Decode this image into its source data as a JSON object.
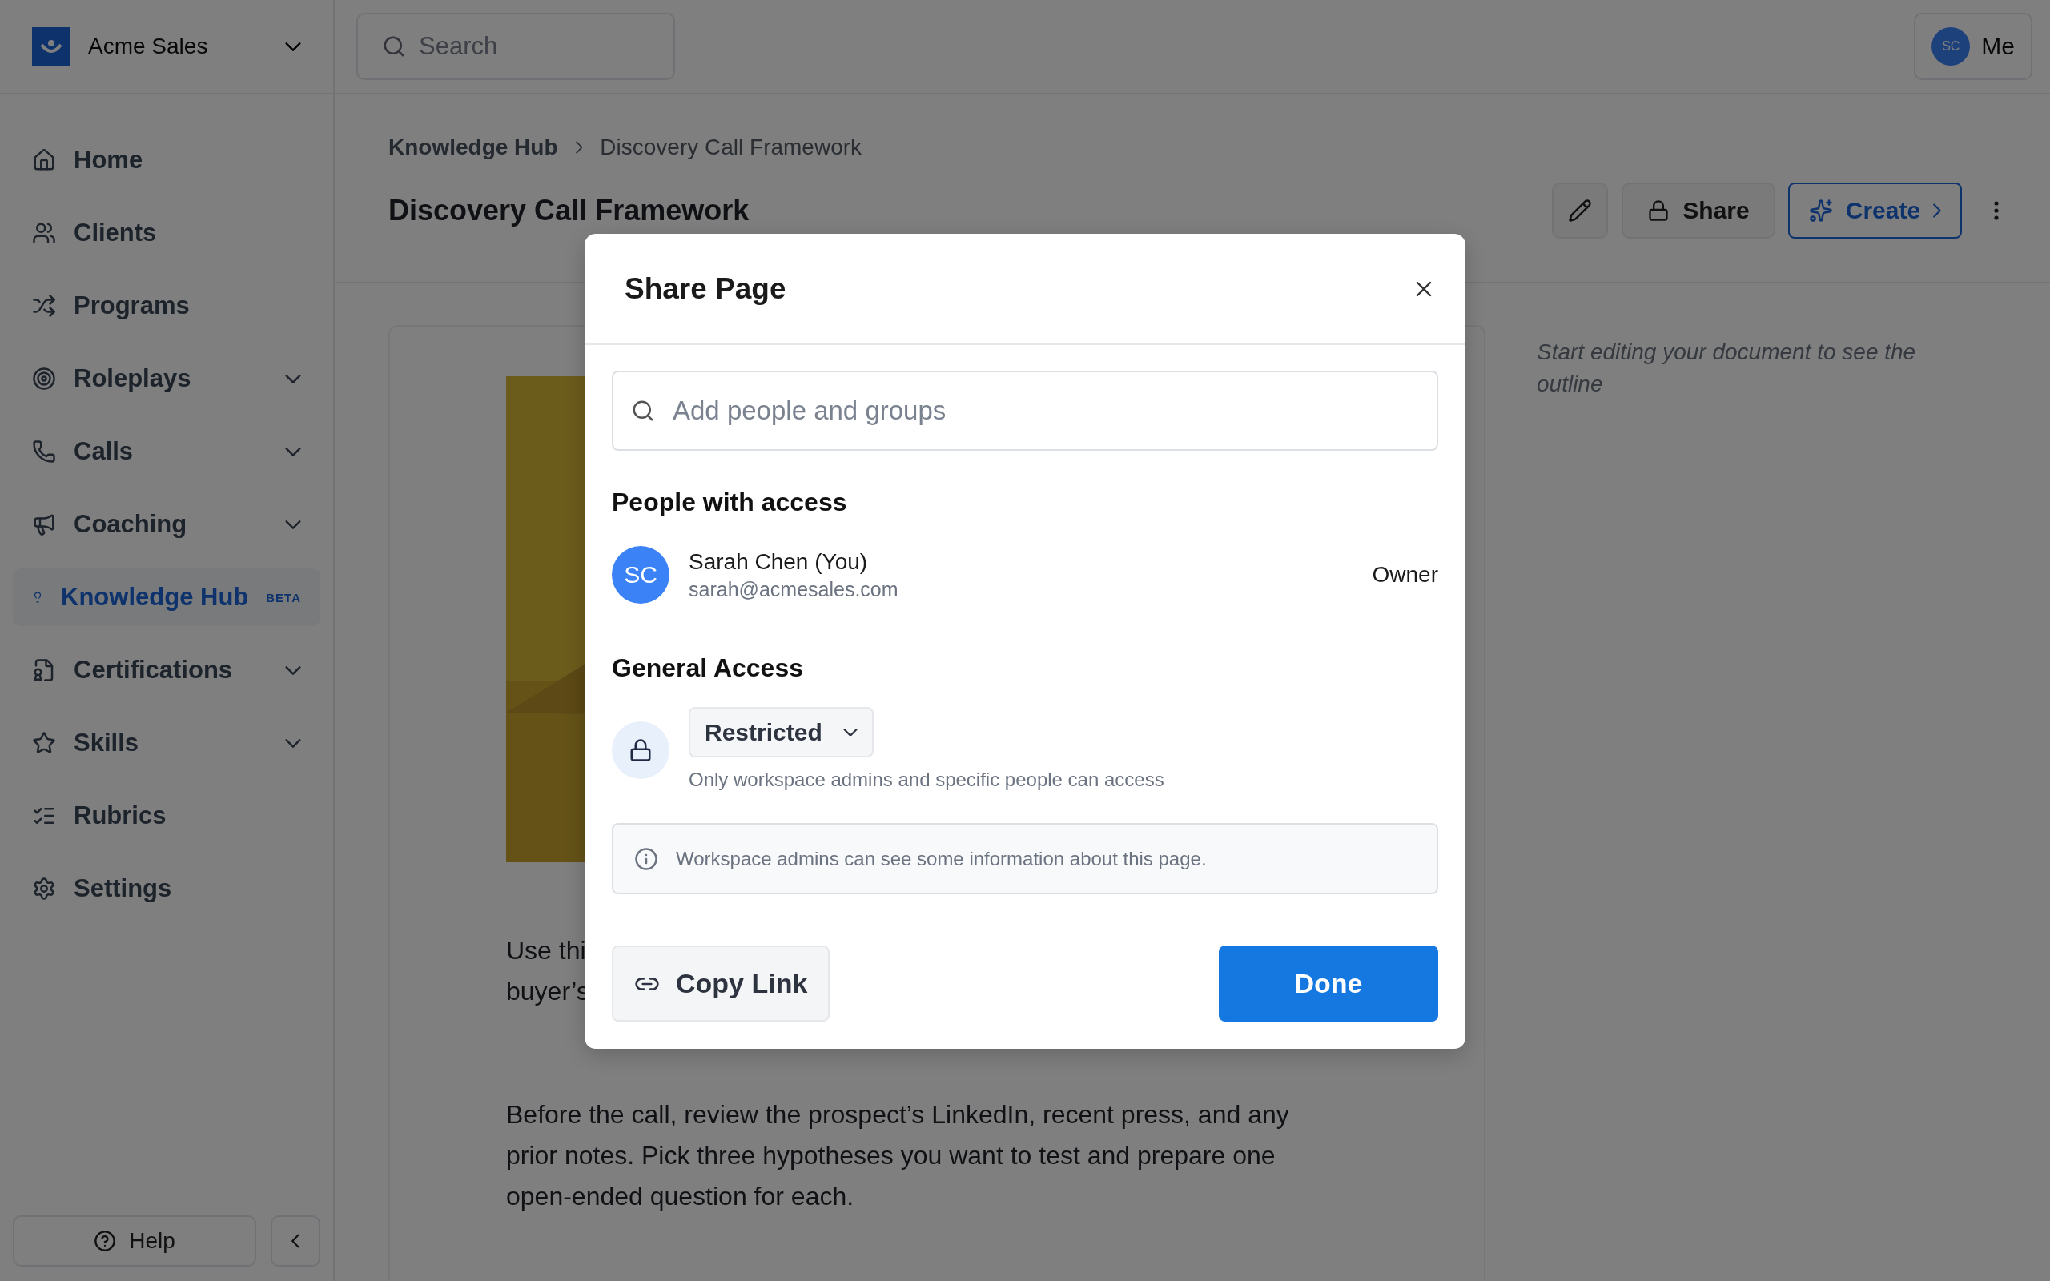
{
  "sidebar": {
    "workspace": "Acme Sales",
    "items": [
      {
        "label": "Home",
        "expandable": false,
        "selected": false
      },
      {
        "label": "Clients",
        "expandable": false,
        "selected": false
      },
      {
        "label": "Programs",
        "expandable": false,
        "selected": false
      },
      {
        "label": "Roleplays",
        "expandable": true,
        "selected": false
      },
      {
        "label": "Calls",
        "expandable": true,
        "selected": false
      },
      {
        "label": "Coaching",
        "expandable": true,
        "selected": false
      },
      {
        "label": "Knowledge Hub",
        "badge": "BETA",
        "expandable": false,
        "selected": true
      },
      {
        "label": "Certifications",
        "expandable": true,
        "selected": false
      },
      {
        "label": "Skills",
        "expandable": true,
        "selected": false
      },
      {
        "label": "Rubrics",
        "expandable": false,
        "selected": false
      },
      {
        "label": "Settings",
        "expandable": false,
        "selected": false
      }
    ],
    "help": "Help"
  },
  "topbar": {
    "search_placeholder": "Search",
    "user": {
      "initials": "SC",
      "label": "Me"
    }
  },
  "breadcrumb": [
    "Knowledge Hub",
    "Discovery Call Framework"
  ],
  "page_title": "Discovery Call Framework",
  "actions": {
    "share": "Share",
    "create": "Create"
  },
  "document": {
    "paragraphs": [
      {
        "lines": [
          "Use thi",
          "buyer’s"
        ]
      },
      {
        "lines": [
          "Before the call, review the prospect’s LinkedIn, recent press, and any",
          "prior notes. Pick three hypotheses you want to test and prepare one",
          "open-ended question for each."
        ]
      }
    ]
  },
  "outline_hint": {
    "lines": [
      "Start editing your document to see the",
      "outline"
    ]
  },
  "share_dialog": {
    "title": "Share Page",
    "search_placeholder": "Add people and groups",
    "people_heading": "People with access",
    "people": [
      {
        "initials": "SC",
        "name": "Sarah Chen (You)",
        "email": "sarah@acmesales.com",
        "role": "Owner"
      }
    ],
    "general_heading": "General Access",
    "access": {
      "value": "Restricted",
      "description": "Only workspace admins and specific people can access"
    },
    "info": "Workspace admins can see some information about this page.",
    "copy_link": "Copy Link",
    "done": "Done"
  }
}
